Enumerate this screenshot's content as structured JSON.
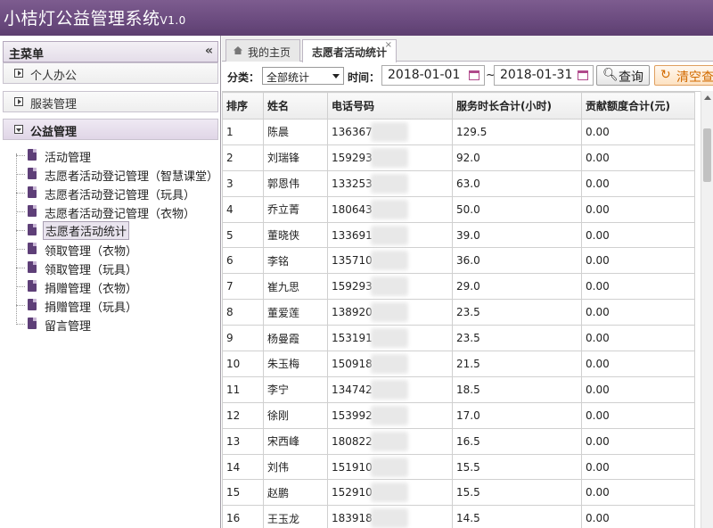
{
  "app": {
    "title": "小桔灯公益管理系统",
    "version": "V1.0"
  },
  "sidebar": {
    "header": "主菜单",
    "collapse_glyph": "«",
    "panels": [
      {
        "label": "个人办公",
        "state": "collapsed"
      },
      {
        "label": "服装管理",
        "state": "collapsed"
      },
      {
        "label": "公益管理",
        "state": "expanded"
      }
    ],
    "tree": [
      {
        "label": "活动管理"
      },
      {
        "label": "志愿者活动登记管理（智慧课堂）"
      },
      {
        "label": "志愿者活动登记管理（玩具）"
      },
      {
        "label": "志愿者活动登记管理（衣物）"
      },
      {
        "label": "志愿者活动统计",
        "selected": true
      },
      {
        "label": "领取管理（衣物）"
      },
      {
        "label": "领取管理（玩具）"
      },
      {
        "label": "捐赠管理（衣物）"
      },
      {
        "label": "捐赠管理（玩具）"
      },
      {
        "label": "留言管理"
      }
    ]
  },
  "tabs": [
    {
      "label": "我的主页"
    },
    {
      "label": "志愿者活动统计",
      "close": "×"
    }
  ],
  "filter": {
    "category_label": "分类：",
    "category_value": "全部统计",
    "time_label": "时间：",
    "start_date": "2018-01-01",
    "tilde": "~",
    "end_date": "2018-01-31",
    "search_label": "查询",
    "clear_label": "清空查"
  },
  "table": {
    "columns": [
      "排序",
      "姓名",
      "电话号码",
      "服务时长合计(小时)",
      "贡献额度合计(元)"
    ],
    "rows": [
      [
        "1",
        "陈晨",
        "136367",
        "129.5",
        "0.00"
      ],
      [
        "2",
        "刘瑞锋",
        "159293",
        "92.0",
        "0.00"
      ],
      [
        "3",
        "郭恩伟",
        "133253",
        "63.0",
        "0.00"
      ],
      [
        "4",
        "乔立菁",
        "180643",
        "50.0",
        "0.00"
      ],
      [
        "5",
        "董晓侠",
        "133691",
        "39.0",
        "0.00"
      ],
      [
        "6",
        "李铭",
        "135710",
        "36.0",
        "0.00"
      ],
      [
        "7",
        "崔九思",
        "159293",
        "29.0",
        "0.00"
      ],
      [
        "8",
        "董爱莲",
        "138920",
        "23.5",
        "0.00"
      ],
      [
        "9",
        "杨曼霞",
        "153191",
        "23.5",
        "0.00"
      ],
      [
        "10",
        "朱玉梅",
        "150918",
        "21.5",
        "0.00"
      ],
      [
        "11",
        "李宁",
        "134742",
        "18.5",
        "0.00"
      ],
      [
        "12",
        "徐刚",
        "153992",
        "17.0",
        "0.00"
      ],
      [
        "13",
        "宋西峰",
        "180822",
        "16.5",
        "0.00"
      ],
      [
        "14",
        "刘伟",
        "151910",
        "15.5",
        "0.00"
      ],
      [
        "15",
        "赵鹏",
        "152910",
        "15.5",
        "0.00"
      ],
      [
        "16",
        "王玉龙",
        "183918",
        "14.5",
        "0.00"
      ]
    ]
  },
  "colors": {
    "header_bg": "#6a4a7e",
    "accent": "#5e3f78",
    "clear_btn": "#d26a00"
  }
}
